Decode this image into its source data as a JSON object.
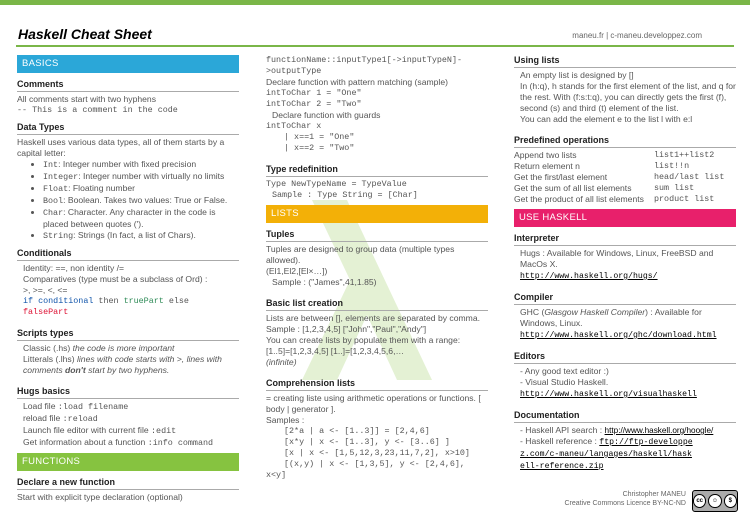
{
  "header": {
    "title": "Haskell Cheat Sheet",
    "site": "maneu.fr | c-maneu.developpez.com"
  },
  "col1": {
    "basics": "BASICS",
    "comments_h": "Comments",
    "comments_t": "All comments start with two hyphens",
    "comments_c": "-- This is a comment in the code",
    "dt_h": "Data Types",
    "dt_t": "Haskell uses various data types, all of them starts by a capital letter:",
    "dt_items": [
      {
        "k": "Int",
        "d": ": Integer number with fixed precision"
      },
      {
        "k": "Integer",
        "d": ": Integer number with virtually no limits"
      },
      {
        "k": "Float",
        "d": ": Floating number"
      },
      {
        "k": "Bool",
        "d": ": Boolean. Takes two values: True or False."
      },
      {
        "k": "Char",
        "d": ": Character. Any character in the code is placed between quotes (')."
      },
      {
        "k": "String",
        "d": ": Strings (In fact, a list of Chars)."
      }
    ],
    "cond_h": "Conditionals",
    "cond_1": "Identity: ==, non identity /=",
    "cond_2": "Comparatives (type must be a subclass of Ord) :",
    "cond_3": ">, >=, <, <=",
    "cond_if": "if",
    "cond_cond": "conditional",
    "cond_then": "then",
    "cond_tp": "truePart",
    "cond_else": "else",
    "cond_fp": "falsePart",
    "scr_h": "Scripts types",
    "scr_1a": "Classic (.hs) ",
    "scr_1b": "the code is more important",
    "scr_2a": "Litterals (.lhs) ",
    "scr_2b": "lines with code starts with >, lines with comments ",
    "scr_2c": "don't",
    "scr_2d": " start by two hyphens.",
    "hugs_h": "Hugs basics",
    "hugs": [
      {
        "t": "Load file ",
        "c": ":load filename"
      },
      {
        "t": "reload file ",
        "c": ":reload"
      },
      {
        "t": "Launch file editor with current file ",
        "c": ":edit"
      },
      {
        "t": "Get information about a function ",
        "c": ":info command"
      }
    ],
    "functions": "FUNCTIONS",
    "decl_h": "Declare a new function",
    "decl_t": "Start with explicit type declaration (optional)"
  },
  "col2": {
    "c1": "functionName::inputType1[->inputTypeN]->outputType",
    "t1": "Declare function with pattern matching (sample)",
    "c2": "intToChar 1 = \"One\"",
    "c3": "intToChar 2 = \"Two\"",
    "t2": "Declare function with guards",
    "c4": "intToChar x",
    "c5": "| x==1 = \"One\"",
    "c6": "| x==2 = \"Two\"",
    "tr_h": "Type redefinition",
    "tr_1": "Type NewTypeName = TypeValue",
    "tr_2": "Sample : Type String = [Char]",
    "lists": "LISTS",
    "tup_h": "Tuples",
    "tup_t": "Tuples are designed to group data (multiple types allowed).",
    "tup_c": "(El1,El2,[El×…])",
    "tup_s": "Sample : (\"James\",41,1.85)",
    "blc_h": "Basic list creation",
    "blc_t": "Lists are between [], elements are separated by comma.",
    "blc_s1": "Sample : [1,2,3,4,5]   [\"John\",\"Paul\",\"Andy\"]",
    "blc_t2": "You can create lists by populate them with a range:",
    "blc_r": "[1..5]=[1,2,3,4,5]  [1..]=[1,2,3,4,5,6,…",
    "blc_inf": "(infinite)",
    "cl_h": "Comprehension lists",
    "cl_t": "= creating liste using arithmetic operations or functions. [ body | generator ].",
    "cl_s": "Samples :",
    "cl_1": "[2*a | a <- [1..3]] = [2,4,6]",
    "cl_2": "[x*y | x <- [1..3], y <- [3..6] ]",
    "cl_3": "[x | x <- [1,5,12,3,23,11,7,2], x>10]",
    "cl_4": "[(x,y) | x <- [1,3,5], y <- [2,4,6],",
    "cl_5": "x<y]"
  },
  "col3": {
    "ul_h": "Using lists",
    "ul_1": "An empty list is designed by []",
    "ul_2": "In (h:q), h stands for the first element of the list, and q for the rest. With (f:s:t:q), you can directly gets the first (f), second (s) and third (t) element of the list.",
    "ul_3": "You can add the element e to the list l with e:l",
    "po_h": "Predefined operations",
    "po": [
      {
        "t": "Append two lists",
        "c": "list1++list2"
      },
      {
        "t": "Return element n",
        "c": "list!!n"
      },
      {
        "t": "Get the first/last element",
        "c": "head/last list"
      },
      {
        "t": "Get the sum of all list elements",
        "c": "sum list"
      },
      {
        "t": "Get the product of all list elements",
        "c": "product list"
      }
    ],
    "use": "USE HASKELL",
    "int_h": "Interpreter",
    "int_t": "Hugs : Available for Windows, Linux, FreeBSD and MacOs X.",
    "int_l": "http://www.haskell.org/hugs/",
    "comp_h": "Compiler",
    "comp_t1": "GHC (",
    "comp_t2": "Glasgow Haskell Compiler",
    "comp_t3": ") : Available for Windows, Linux.",
    "comp_l": "http://www.haskell.org/ghc/download.html",
    "ed_h": "Editors",
    "ed_1": "- Any good text editor :)",
    "ed_2": "- Visual Studio Haskell.",
    "ed_l": "http://www.haskell.org/visualhaskell",
    "doc_h": "Documentation",
    "doc_1": "- Haskell API search : ",
    "doc_1l": "http://www.haskell.org/hoogle/",
    "doc_2": "- Haskell reference : ",
    "doc_2l": "ftp://ftp-developpez.com/c-maneu/langages/haskell/haskell-reference.zip"
  },
  "footer": {
    "author": "Christopher MANEU",
    "licence": "Creative Commons Licence BY-NC-ND",
    "cc": "cc"
  },
  "colors": {
    "green": "#86c340",
    "blue": "#2ba7d8",
    "orange": "#f3b007",
    "pink": "#e8206b"
  }
}
